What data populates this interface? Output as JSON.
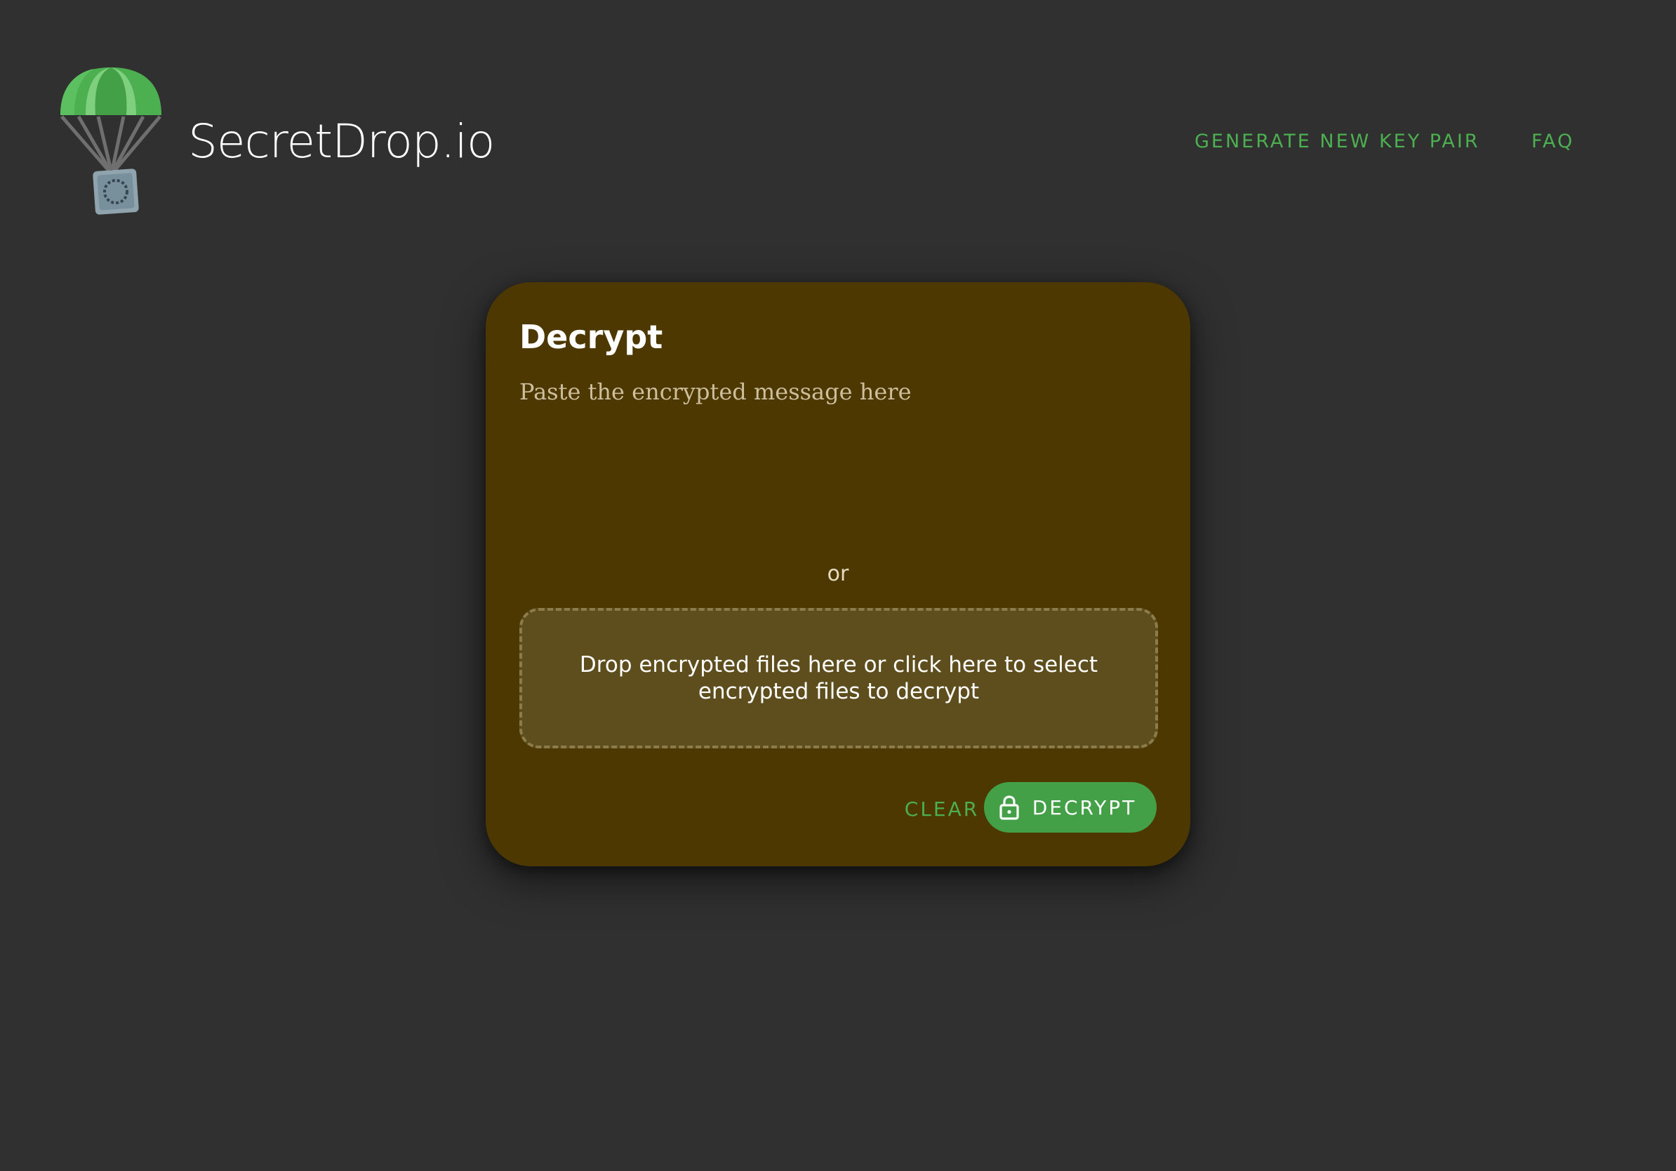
{
  "header": {
    "brand": "SecretDrop.io",
    "nav": {
      "generate_key_pair": "GENERATE NEW KEY PAIR",
      "faq": "FAQ"
    }
  },
  "card": {
    "title": "Decrypt",
    "message_placeholder": "Paste the encrypted message here",
    "message_value": "",
    "or_text": "or",
    "dropzone_text": "Drop encrypted files here or click here to select encrypted files to decrypt",
    "clear_label": "CLEAR",
    "decrypt_label": "DECRYPT",
    "decrypt_icon": "lock-icon"
  },
  "colors": {
    "background": "#303030",
    "card": "#4c3800",
    "dropzone": "#5f4e1d",
    "accent": "#4caf50",
    "button": "#43a047"
  }
}
